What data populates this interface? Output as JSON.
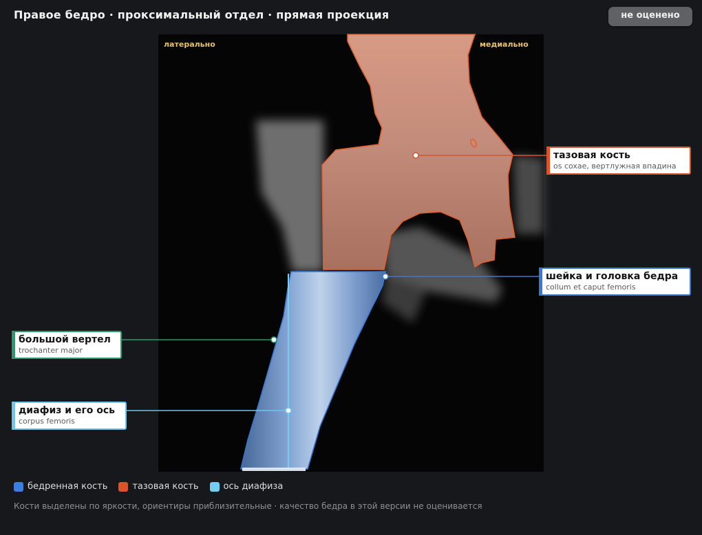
{
  "header": {
    "title": "Правое бедро · проксимальный отдел · прямая проекция",
    "status_badge": "не оценено"
  },
  "image": {
    "orientation_left": "латерально",
    "orientation_right": "медиально"
  },
  "callouts": {
    "pelvis": {
      "name": "тазовая кость",
      "latin": "os coxae, вертлужная впадина",
      "color": "#d9542b"
    },
    "neck": {
      "name": "шейка и головка бедра",
      "latin": "collum et caput femoris",
      "color": "#3a78d4"
    },
    "trochanter": {
      "name": "большой вертел",
      "latin": "trochanter major",
      "color": "#2a9a6e"
    },
    "shaft": {
      "name": "диафиз и его ось",
      "latin": "corpus femoris",
      "color": "#6cc7ee"
    }
  },
  "legend": [
    {
      "label": "бедренная кость",
      "color": "#3a7fe0"
    },
    {
      "label": "тазовая кость",
      "color": "#d9542b"
    },
    {
      "label": "ось диафиза",
      "color": "#74cdf2"
    }
  ],
  "footnote": "Кости выделены по яркости, ориентиры приблизительные · качество бедра в этой версии не оценивается"
}
